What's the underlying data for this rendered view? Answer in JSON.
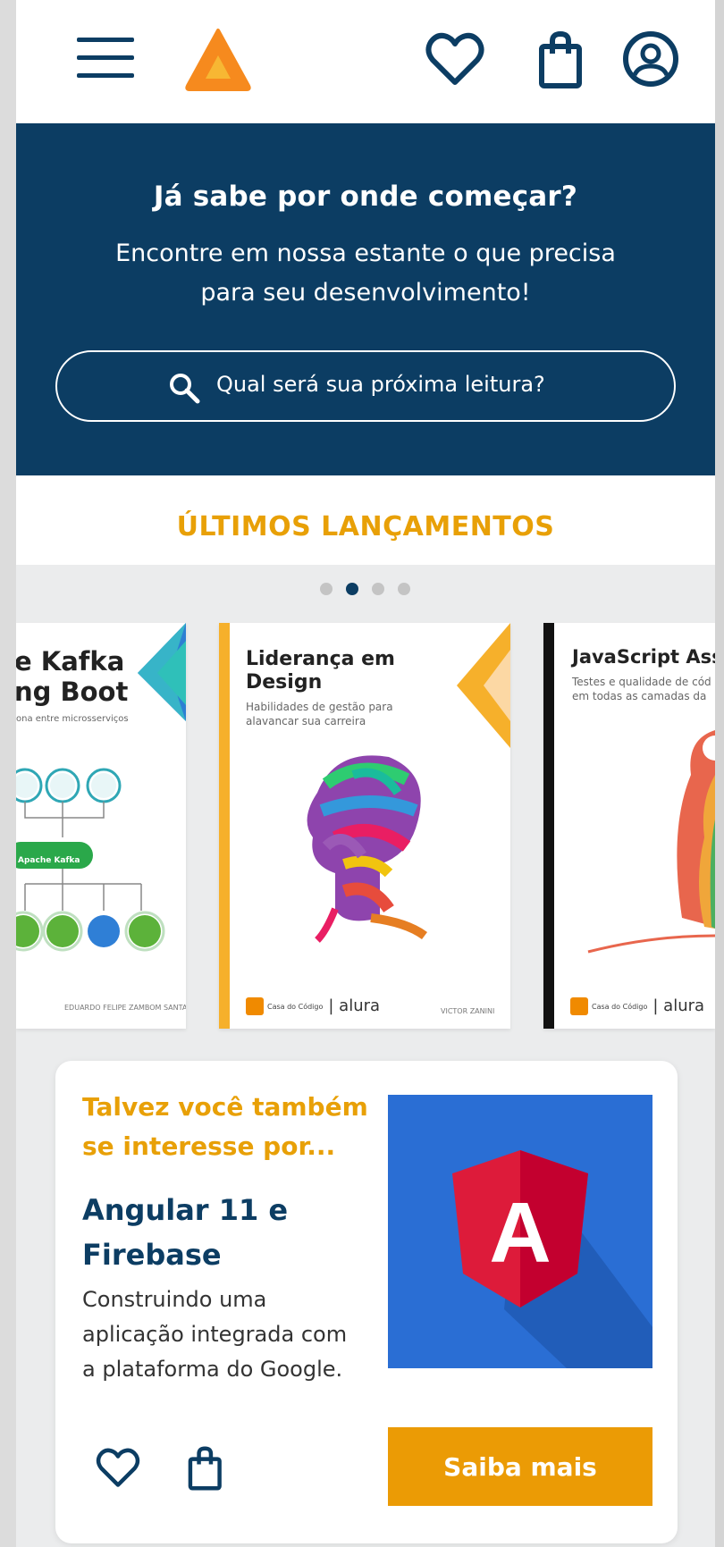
{
  "header": {
    "menu_icon": "hamburger-menu-icon",
    "logo_icon": "triangle-logo-icon",
    "icons": [
      "heart-icon",
      "shopping-bag-icon",
      "user-account-icon"
    ]
  },
  "hero": {
    "title": "Já sabe por onde começar?",
    "subtitle": "Encontre em nossa estante o que precisa para seu desenvolvimento!",
    "search": {
      "placeholder": "Qual será sua próxima leitura?",
      "icon": "search-icon"
    }
  },
  "releases": {
    "title": "ÚLTIMOS LANÇAMENTOS",
    "carousel": {
      "page_count": 4,
      "active_index": 1
    },
    "books": [
      {
        "title_line1": "e Kafka",
        "title_line2": "ng Boot",
        "subtitle": "ona entre microsserviços",
        "diagram_label": "Apache Kafka",
        "author": "EDUARDO FELIPE ZAMBOM SANTANA"
      },
      {
        "title_line1": "Liderança em",
        "title_line2": "Design",
        "subtitle_line1": "Habilidades de gestão para",
        "subtitle_line2": "alavancar sua carreira",
        "author": "VICTOR ZANINI",
        "publisher": "Casa do Código",
        "brand": "alura"
      },
      {
        "title_line1": "JavaScript Ass",
        "subtitle_line1": "Testes e qualidade de cód",
        "subtitle_line2": "em todas as camadas da",
        "publisher": "Casa do Código",
        "brand": "alura"
      }
    ]
  },
  "recommendation": {
    "kicker": "Talvez você também se interesse por...",
    "title": "Angular 11 e Firebase",
    "description": "Construindo uma aplicação integrada com a plataforma do Google.",
    "image_icon": "angular-logo-icon",
    "image_letter": "A",
    "cta_label": "Saiba mais"
  },
  "colors": {
    "primary": "#0c3d63",
    "accent": "#e8a007",
    "button": "#eb9b05",
    "background": "#ebeced"
  }
}
